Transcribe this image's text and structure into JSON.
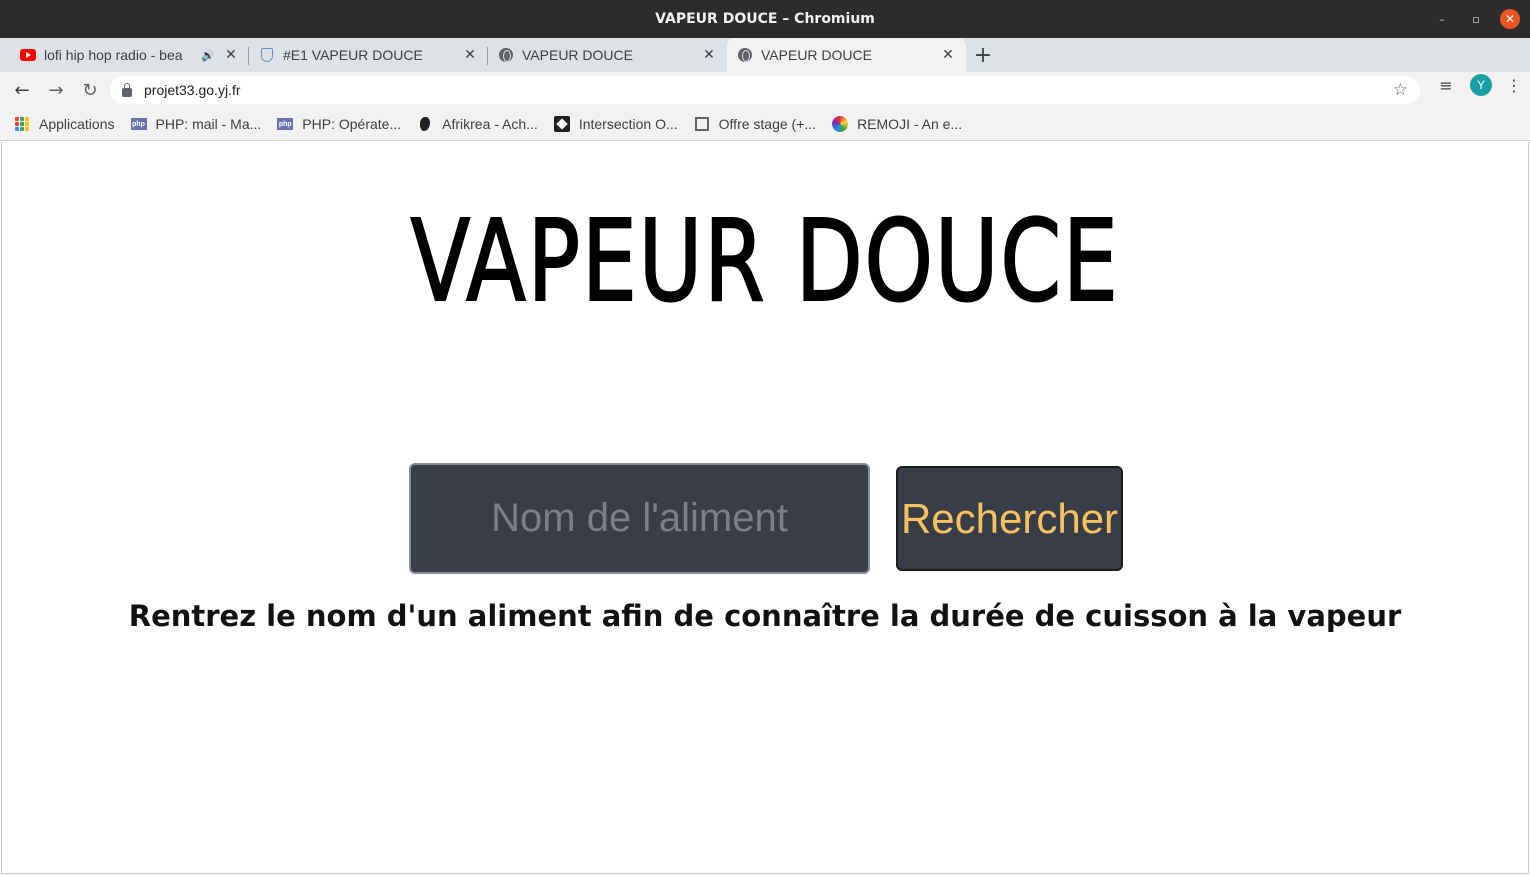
{
  "window": {
    "title": "VAPEUR DOUCE – Chromium",
    "minimize_icon": "–",
    "maximize_icon": "▫",
    "close_icon": "✕"
  },
  "tabs": [
    {
      "label": "lofi hip hop radio - bea",
      "icon": "youtube-icon",
      "audio": "🔊",
      "close": "✕"
    },
    {
      "label": "#E1 VAPEUR DOUCE",
      "icon": "shield-icon",
      "close": "✕"
    },
    {
      "label": "VAPEUR DOUCE",
      "icon": "globe-icon",
      "close": "✕"
    },
    {
      "label": "VAPEUR DOUCE",
      "icon": "globe-icon",
      "close": "✕",
      "active": true
    }
  ],
  "new_tab_label": "+",
  "toolbar": {
    "back": "←",
    "forward": "→",
    "reload": "↻",
    "url": "projet33.go.yj.fr",
    "star": "☆",
    "queue": "≡",
    "avatar_letter": "Y",
    "menu": "⋮"
  },
  "bookmarks": [
    {
      "label": "Applications",
      "icon": "apps-grid-icon"
    },
    {
      "label": "PHP: mail - Ma...",
      "icon": "php-icon"
    },
    {
      "label": "PHP: Opérate...",
      "icon": "php-icon"
    },
    {
      "label": "Afrikrea - Ach...",
      "icon": "africa-icon"
    },
    {
      "label": "Intersection O...",
      "icon": "intersection-icon"
    },
    {
      "label": "Offre stage (+...",
      "icon": "stage-icon"
    },
    {
      "label": "REMOJI - An e...",
      "icon": "remoji-icon"
    }
  ],
  "page": {
    "logo_text": "VAPEUR DOUCE",
    "search_placeholder": "Nom de l'aliment",
    "search_button": "Rechercher",
    "helper_text": "Rentrez le nom d'un aliment afin de connaître la durée de cuisson à la vapeur"
  },
  "colors": {
    "input_bg": "#393d47",
    "button_text": "#f6c260",
    "titlebar": "#2c2c2c",
    "close_button": "#e95420"
  }
}
